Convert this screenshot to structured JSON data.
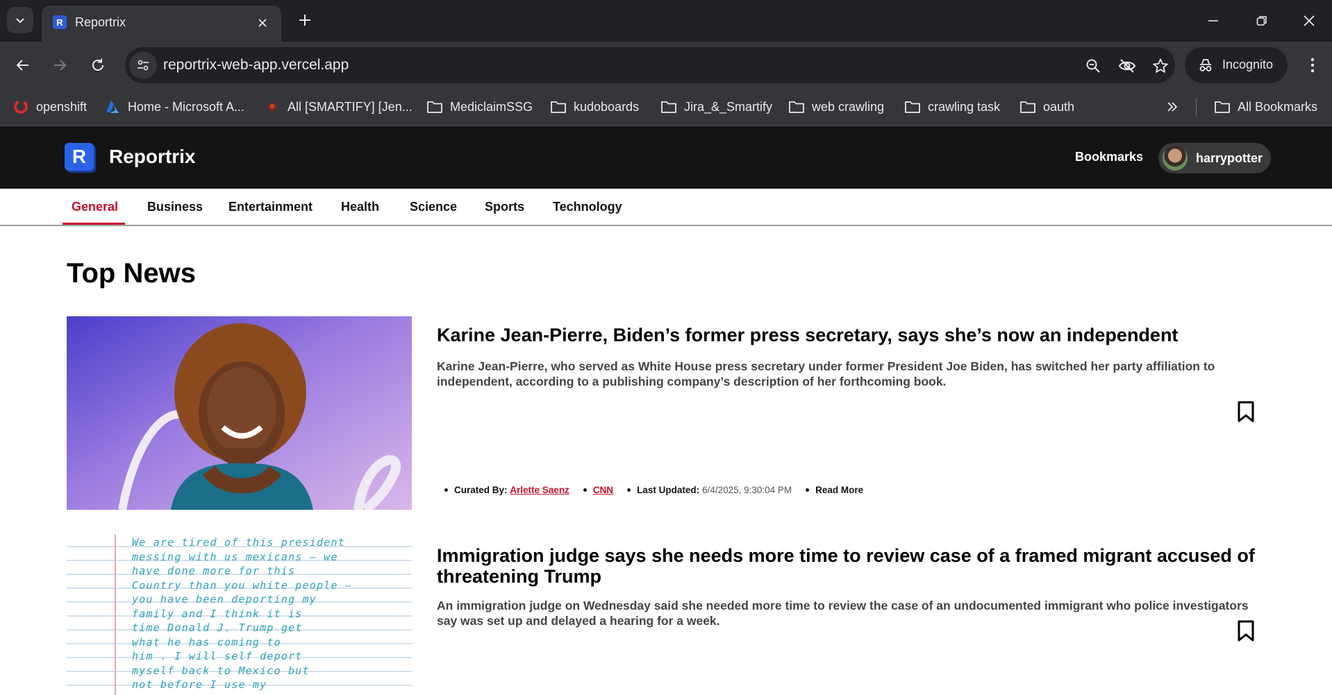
{
  "browser": {
    "tab_title": "Reportrix",
    "tab_favicon_letter": "R",
    "url": "reportrix-web-app.vercel.app",
    "incognito_label": "Incognito",
    "bookmarks": [
      {
        "label": "openshift",
        "icon": "openshift-icon"
      },
      {
        "label": "Home - Microsoft A...",
        "icon": "azure-icon"
      },
      {
        "label": "All [SMARTIFY] [Jen...",
        "icon": "jenkins-icon"
      },
      {
        "label": "MediclaimSSG",
        "icon": "folder-icon"
      },
      {
        "label": "kudoboards",
        "icon": "folder-icon"
      },
      {
        "label": "Jira_&_Smartify",
        "icon": "folder-icon"
      },
      {
        "label": "web crawling",
        "icon": "folder-icon"
      },
      {
        "label": "crawling task",
        "icon": "folder-icon"
      },
      {
        "label": "oauth",
        "icon": "folder-icon"
      }
    ],
    "all_bookmarks_label": "All Bookmarks"
  },
  "header": {
    "logo_letter": "R",
    "brand": "Reportrix",
    "bookmarks_link": "Bookmarks",
    "username": "harrypotter"
  },
  "categories": [
    "General",
    "Business",
    "Entertainment",
    "Health",
    "Science",
    "Sports",
    "Technology"
  ],
  "active_category": "General",
  "main": {
    "heading": "Top News",
    "articles": [
      {
        "title": "Karine Jean-Pierre, Biden’s former press secretary, says she’s now an independent",
        "description": "Karine Jean-Pierre, who served as White House press secretary under former President Joe Biden, has switched her party affiliation to independent, according to a publishing company’s description of her forthcoming book.",
        "curated_by_label": "Curated By:",
        "author": "Arlette Saenz",
        "source": "CNN",
        "last_updated_label": "Last Updated:",
        "last_updated": "6/4/2025, 9:30:04 PM",
        "read_more": "Read More"
      },
      {
        "title": "Immigration judge says she needs more time to review case of a framed migrant accused of threatening Trump",
        "description": "An immigration judge on Wednesday said she needed more time to review the case of an undocumented immigrant who police investigators say was set up and delayed a hearing for a week.",
        "handwritten_note": [
          "We are tired of this president",
          "messing with us mexicans — we",
          "have done more for this",
          "Country than you white people —",
          "you have been deporting my",
          "family and I think it is",
          "time Donald J. Trump get",
          "what he has coming to",
          "him . I will self deport",
          "myself back to Mexico but",
          "not before I use my"
        ]
      }
    ]
  }
}
